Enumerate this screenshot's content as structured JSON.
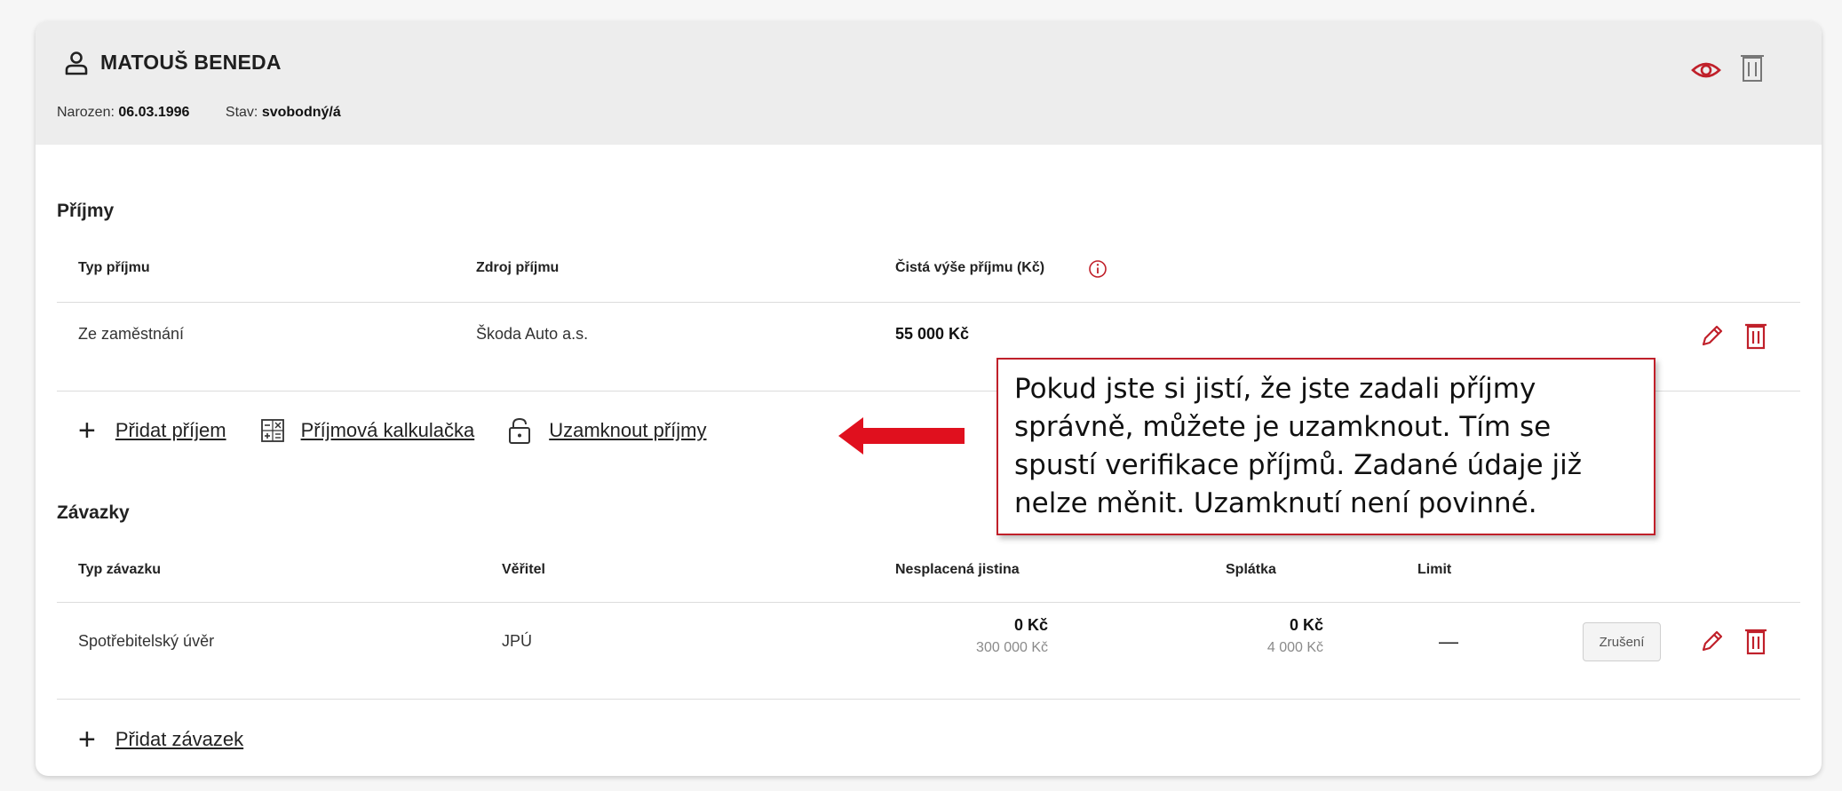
{
  "person": {
    "name": "MATOUŠ BENEDA",
    "born_label": "Narozen:",
    "born_value": "06.03.1996",
    "status_label": "Stav:",
    "status_value": "svobodný/á"
  },
  "income": {
    "title": "Příjmy",
    "headers": [
      "Typ příjmu",
      "Zdroj příjmu",
      "Čistá výše příjmu (Kč)"
    ],
    "rows": [
      {
        "type": "Ze zaměstnání",
        "source": "Škoda Auto a.s.",
        "amount": "55 000 Kč"
      }
    ],
    "actions": {
      "add": "Přidat příjem",
      "calculator": "Příjmová kalkulačka",
      "lock": "Uzamknout příjmy"
    }
  },
  "callout": {
    "text": "Pokud jste si jistí, že jste zadali příjmy správně, můžete je uzamknout. Tím se spustí verifikace příjmů. Zadané údaje již nelze měnit. Uzamknutí není povinné."
  },
  "liabilities": {
    "title": "Závazky",
    "headers": [
      "Typ závazku",
      "Věřitel",
      "Nesplacená jistina",
      "Splátka",
      "Limit"
    ],
    "rows": [
      {
        "type": "Spotřebitelský úvěr",
        "creditor": "JPÚ",
        "principal": "0 Kč",
        "principal_sub": "300 000 Kč",
        "installment": "0 Kč",
        "installment_sub": "4 000 Kč",
        "limit": "—",
        "cancel_label": "Zrušení"
      }
    ],
    "actions": {
      "add": "Přidat závazek"
    }
  },
  "colors": {
    "accent": "#c0202a",
    "header_bg": "#ededed"
  },
  "icons": [
    "person-icon",
    "eye-icon",
    "trash-icon",
    "info-icon",
    "pencil-icon",
    "plus-icon",
    "calculator-icon",
    "lock-icon",
    "arrow-left-icon"
  ]
}
